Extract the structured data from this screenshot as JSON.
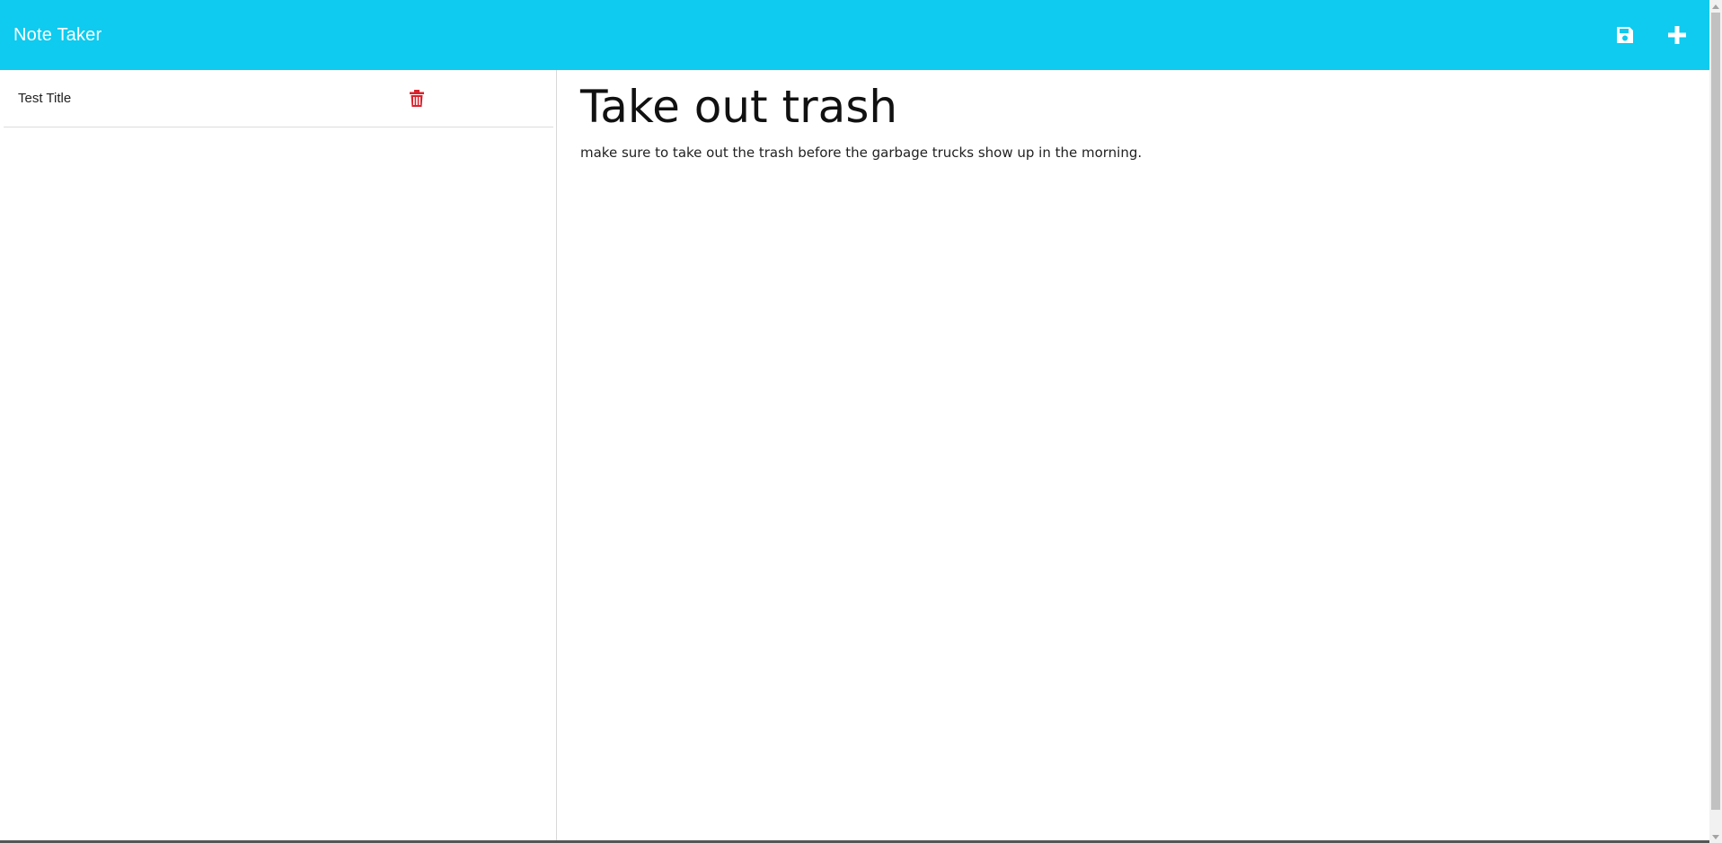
{
  "app": {
    "title": "Note Taker",
    "accent_color": "#0ecbef"
  },
  "toolbar": {
    "save_icon": "save-icon",
    "new_icon": "plus-icon"
  },
  "notes": [
    {
      "title": "Test Title",
      "delete_icon": "trash-icon",
      "delete_color": "#d9232e"
    }
  ],
  "active_note": {
    "title": "Take out trash",
    "text": "make sure to take out the trash before the garbage trucks show up in the morning."
  }
}
